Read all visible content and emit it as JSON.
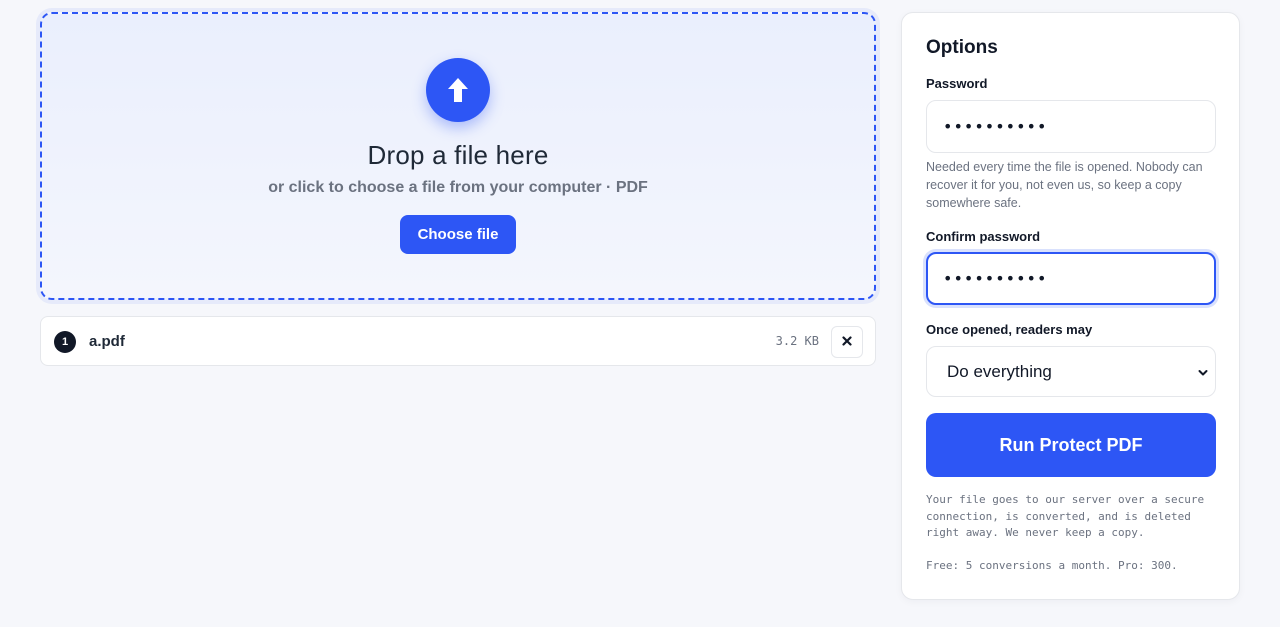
{
  "dropzone": {
    "icon": "upload-arrow-icon",
    "title": "Drop a file here",
    "subtitle": "or click to choose a file from your computer · PDF",
    "choose_label": "Choose file"
  },
  "files": [
    {
      "index": "1",
      "name": "a.pdf",
      "size": "3.2 KB",
      "remove_icon": "close-icon"
    }
  ],
  "options": {
    "title": "Options",
    "password_label": "Password",
    "password_value": "••••••••••",
    "password_help": "Needed every time the file is opened. Nobody can recover it for you, not even us, so keep a copy somewhere safe.",
    "confirm_label": "Confirm password",
    "confirm_value": "••••••••••",
    "permissions_label": "Once opened, readers may",
    "permissions_value": "Do everything",
    "run_label": "Run Protect PDF",
    "privacy_note": "Your file goes to our server over a secure connection, is converted, and is deleted right away. We never keep a copy.",
    "quota_note": "Free: 5 conversions a month. Pro: 300."
  },
  "colors": {
    "accent": "#2d56f5",
    "page_bg": "#f6f7fb",
    "muted_text": "#6b7280"
  }
}
